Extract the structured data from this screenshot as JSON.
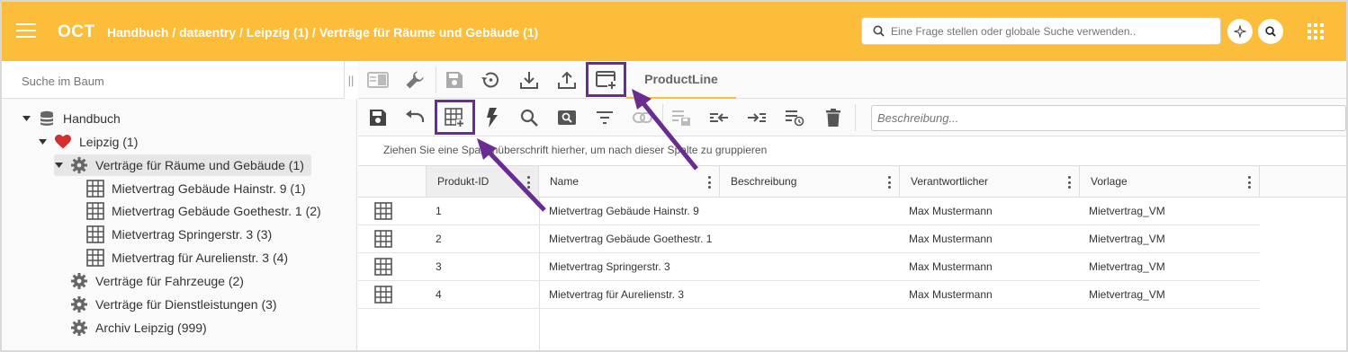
{
  "header": {
    "app_title": "OCT",
    "breadcrumb": "Handbuch / dataentry / Leipzig (1) / Verträge für Räume und Gebäude (1)",
    "search_placeholder": "Eine Frage stellen oder globale Suche verwenden..",
    "icons": [
      "menu-icon",
      "search-icon",
      "sparkle-icon",
      "search-icon",
      "apps-grid-icon"
    ]
  },
  "tree": {
    "search_placeholder": "Suche im Baum",
    "nodes": [
      {
        "label": "Handbuch",
        "icon": "database-icon"
      },
      {
        "label": "Leipzig (1)",
        "icon": "heart-icon"
      },
      {
        "label": "Verträge für Räume und Gebäude (1)",
        "icon": "gear-icon"
      },
      {
        "label": "Mietvertrag Gebäude Hainstr. 9 (1)",
        "icon": "table-icon"
      },
      {
        "label": "Mietvertrag Gebäude Goethestr. 1 (2)",
        "icon": "table-icon"
      },
      {
        "label": "Mietvertrag Springerstr. 3 (3)",
        "icon": "table-icon"
      },
      {
        "label": "Mietvertrag für Aurelienstr. 3 (4)",
        "icon": "table-icon"
      },
      {
        "label": "Verträge für Fahrzeuge (2)",
        "icon": "gear-icon"
      },
      {
        "label": "Verträge für Dienstleistungen (3)",
        "icon": "gear-icon"
      },
      {
        "label": "Archiv Leipzig (999)",
        "icon": "gear-icon"
      }
    ]
  },
  "toolbar": {
    "tab_label": "ProductLine",
    "description_placeholder": "Beschreibung...",
    "group_hint": "Ziehen Sie eine Spaltenüberschrift hierher, um nach dieser Spalte zu gruppieren"
  },
  "grid": {
    "columns": [
      "Produkt-ID",
      "Name",
      "Beschreibung",
      "Verantwortlicher",
      "Vorlage"
    ],
    "rows": [
      {
        "id": "1",
        "name": "Mietvertrag Gebäude Hainstr. 9",
        "beschreibung": "",
        "verantwortlicher": "Max Mustermann",
        "vorlage": "Mietvertrag_VM"
      },
      {
        "id": "2",
        "name": "Mietvertrag Gebäude Goethestr. 1",
        "beschreibung": "",
        "verantwortlicher": "Max Mustermann",
        "vorlage": "Mietvertrag_VM"
      },
      {
        "id": "3",
        "name": "Mietvertrag Springerstr. 3",
        "beschreibung": "",
        "verantwortlicher": "Max Mustermann",
        "vorlage": "Mietvertrag_VM"
      },
      {
        "id": "4",
        "name": "Mietvertrag für Aurelienstr. 3",
        "beschreibung": "",
        "verantwortlicher": "Max Mustermann",
        "vorlage": "Mietvertrag_VM"
      }
    ]
  },
  "colors": {
    "header_bg": "#fbbd3a",
    "annotation": "#6b2c91",
    "heart": "#d32f2f",
    "icon_gray": "#666666"
  }
}
